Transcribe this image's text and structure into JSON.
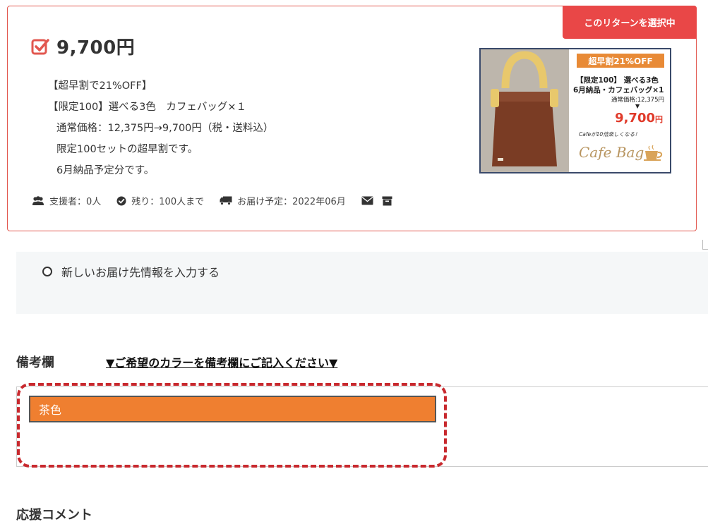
{
  "reward": {
    "selected_badge": "このリターンを選択中",
    "price": "9,700円",
    "description": [
      "【超早割で21%OFF】",
      "【限定100】選べる3色　カフェバッグ×１",
      "通常価格：12,375円→9,700円（税・送料込）",
      "限定100セットの超早割です。",
      "6月納品予定分です。"
    ],
    "meta": {
      "supporters": "支援者：0人",
      "remaining": "残り：100人まで",
      "delivery": "お届け予定：2022年06月"
    },
    "image": {
      "badge": "超早割21%OFF",
      "line1": "【限定100】 選べる3色",
      "line2": "6月納品・カフェバッグ×1",
      "line3": "通常価格:12,375円",
      "arrow": "▼",
      "price": "9,700",
      "price_unit": "円",
      "tagline": "Cafeが10倍楽しくなる！",
      "logo": "Cafe Bag"
    }
  },
  "delivery": {
    "new_address_option": "新しいお届け先情報を入力する"
  },
  "remarks": {
    "label": "備考欄",
    "note": "▼ご希望のカラーを備考欄にご記入ください▼",
    "value": "茶色"
  },
  "support_comment": {
    "label": "応援コメント"
  },
  "colors": {
    "accent_red": "#e94747",
    "card_border": "#e2574f",
    "highlight_orange": "#ef7f30",
    "dashed_red": "#c8292e"
  },
  "icons": [
    "check-square-icon",
    "users-icon",
    "check-circle-icon",
    "truck-icon",
    "envelope-icon",
    "archive-icon",
    "coffee-cup-icon"
  ]
}
